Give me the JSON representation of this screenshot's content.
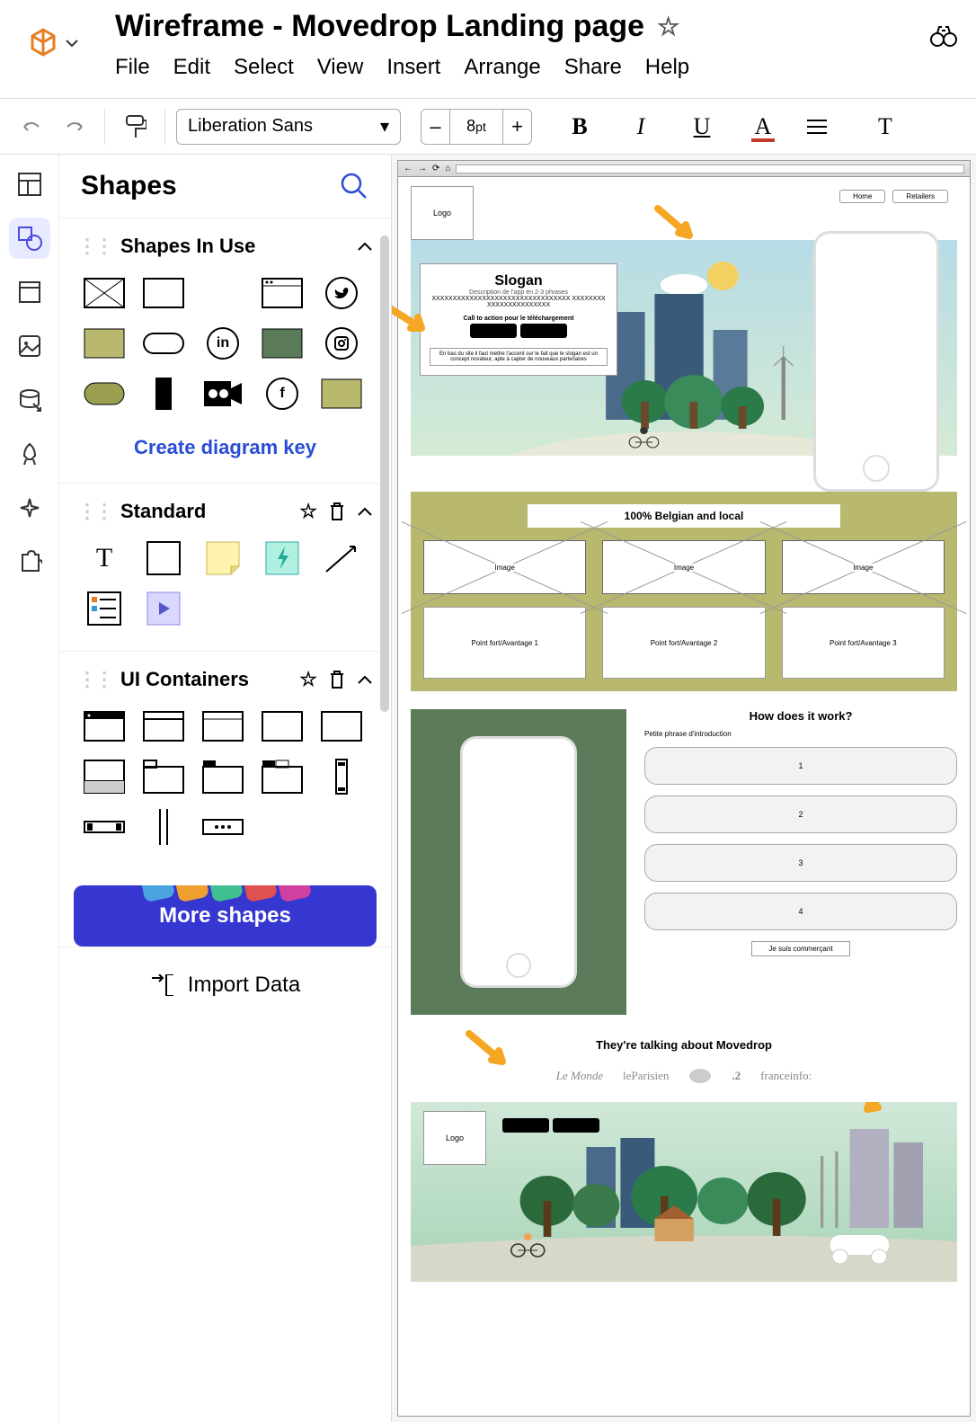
{
  "doc": {
    "title": "Wireframe - Movedrop Landing page"
  },
  "menu": {
    "file": "File",
    "edit": "Edit",
    "select": "Select",
    "view": "View",
    "insert": "Insert",
    "arrange": "Arrange",
    "share": "Share",
    "help": "Help"
  },
  "toolbar": {
    "font": "Liberation Sans",
    "size": "8",
    "unit": "pt",
    "minus": "–",
    "plus": "+",
    "bold": "B",
    "italic": "I",
    "underline": "U",
    "color": "A",
    "text": "T"
  },
  "panel": {
    "title": "Shapes",
    "sec1": "Shapes In Use",
    "dkey": "Create diagram key",
    "sec2": "Standard",
    "sec3": "UI Containers",
    "more": "More shapes",
    "import": "Import Data"
  },
  "wf": {
    "logo": "Logo",
    "nav": {
      "home": "Home",
      "retailers": "Retailers"
    },
    "slogan": "Slogan",
    "desc": "Description de l'app en 2-3 phrases",
    "cta": "Call to action pour le téléchargement",
    "belgian": "100% Belgian and local",
    "img": "Image",
    "adv1": "Point fort/Avantage 1",
    "adv2": "Point fort/Avantage 2",
    "adv3": "Point fort/Avantage 3",
    "how": "How does it work?",
    "intro": "Petite phrase d'introduction",
    "s1": "1",
    "s2": "2",
    "s3": "3",
    "s4": "4",
    "merchant": "Je suis commerçant",
    "press": "They're talking about Movedrop",
    "p1": "Le Monde",
    "p2": "leParisien",
    "p3": ".2",
    "p4": "franceinfo:"
  }
}
